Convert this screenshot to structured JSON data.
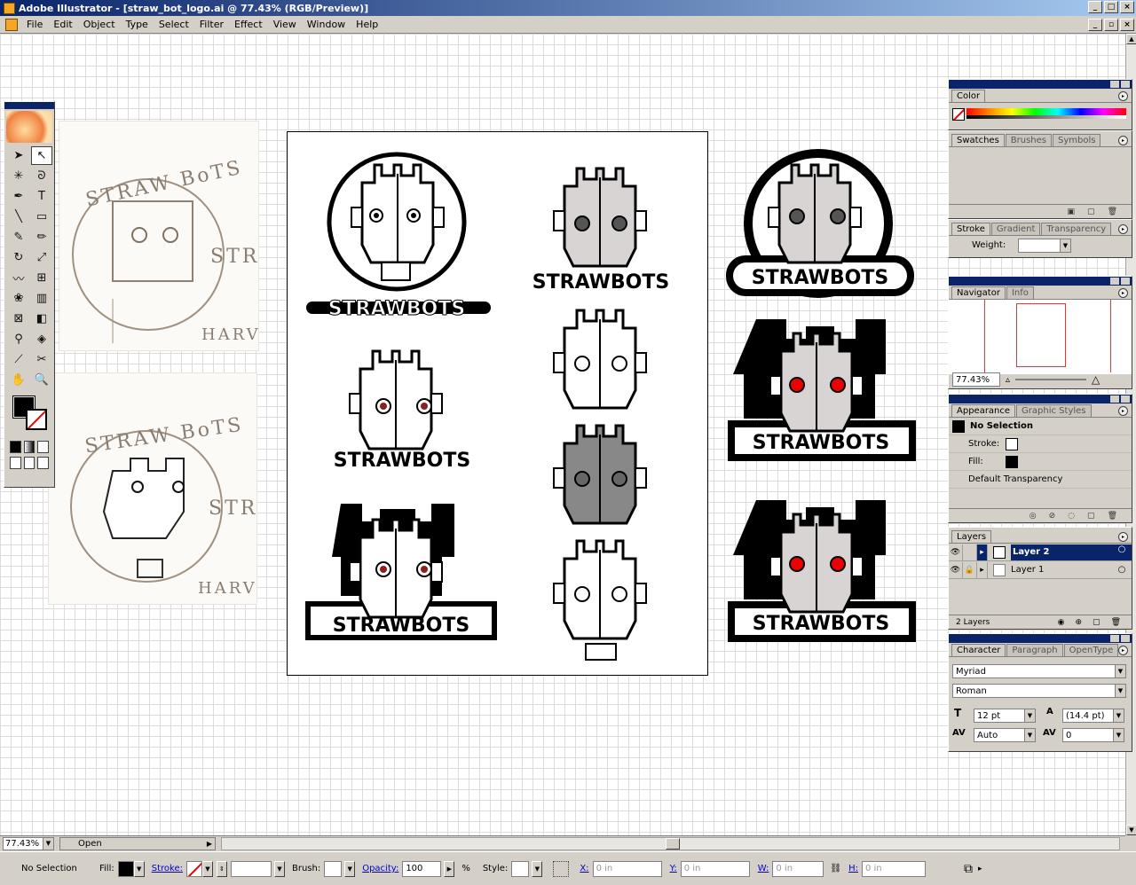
{
  "window": {
    "title": "Adobe Illustrator - [straw_bot_logo.ai @ 77.43% (RGB/Preview)]"
  },
  "menu": [
    "File",
    "Edit",
    "Object",
    "Type",
    "Select",
    "Filter",
    "Effect",
    "View",
    "Window",
    "Help"
  ],
  "logo_text": "STRAWBOTS",
  "sketch_text": {
    "top": "STRAW BoTS",
    "side": "STR",
    "sig": "HARV"
  },
  "panels": {
    "color": {
      "tabs": [
        "Color"
      ]
    },
    "swatches": {
      "tabs": [
        "Swatches",
        "Brushes",
        "Symbols"
      ]
    },
    "stroke": {
      "tabs": [
        "Stroke",
        "Gradient",
        "Transparency"
      ],
      "weight_label": "Weight:"
    },
    "navigator": {
      "tabs": [
        "Navigator",
        "Info"
      ],
      "zoom": "77.43%"
    },
    "appearance": {
      "tabs": [
        "Appearance",
        "Graphic Styles"
      ],
      "header": "No Selection",
      "stroke_label": "Stroke:",
      "fill_label": "Fill:",
      "transparency": "Default Transparency"
    },
    "layers": {
      "tabs": [
        "Layers"
      ],
      "rows": [
        {
          "name": "Layer 2"
        },
        {
          "name": "Layer 1"
        }
      ],
      "count": "2 Layers"
    },
    "character": {
      "tabs": [
        "Character",
        "Paragraph",
        "OpenType"
      ],
      "font": "Myriad",
      "style": "Roman",
      "size": "12 pt",
      "leading": "(14.4 pt)",
      "kerning": "Auto",
      "tracking": "0"
    }
  },
  "status": {
    "zoom": "77.43%",
    "state": "Open"
  },
  "control": {
    "selection": "No Selection",
    "fill": "Fill:",
    "stroke": "Stroke:",
    "brush": "Brush:",
    "opacity": "Opacity:",
    "opacity_value": "100",
    "percent": "%",
    "style": "Style:",
    "x": "X:",
    "y": "Y:",
    "w": "W:",
    "h": "H:",
    "x_val": "0 in",
    "y_val": "0 in",
    "w_val": "0 in",
    "h_val": "0 in"
  },
  "colors": {
    "title_start": "#0a246a",
    "title_end": "#a6caf0",
    "accent_red": "#e00000"
  }
}
